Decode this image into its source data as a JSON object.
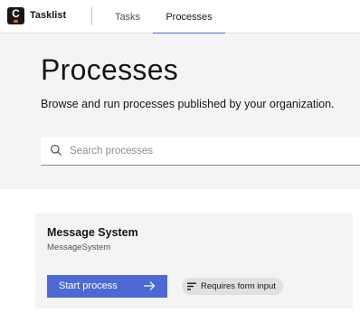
{
  "header": {
    "logo_letter": "C",
    "brand": "Tasklist",
    "tabs": [
      {
        "label": "Tasks",
        "active": false
      },
      {
        "label": "Processes",
        "active": true
      }
    ]
  },
  "hero": {
    "title": "Processes",
    "subtitle": "Browse and run processes published by your organization.",
    "search": {
      "placeholder": "Search processes",
      "value": ""
    }
  },
  "processes": [
    {
      "name": "Message System",
      "id": "MessageSystem",
      "start_label": "Start process",
      "tag": "Requires form input"
    }
  ],
  "colors": {
    "accent": "#4d6ad4",
    "logo_bg": "#161616",
    "logo_dot": "#fc5d0d",
    "panel_bg": "#f4f4f4",
    "tag_bg": "#e0e0e0"
  },
  "icons": {
    "search": "search-icon",
    "start": "arrow-right-icon",
    "tag": "text-lines-icon"
  }
}
